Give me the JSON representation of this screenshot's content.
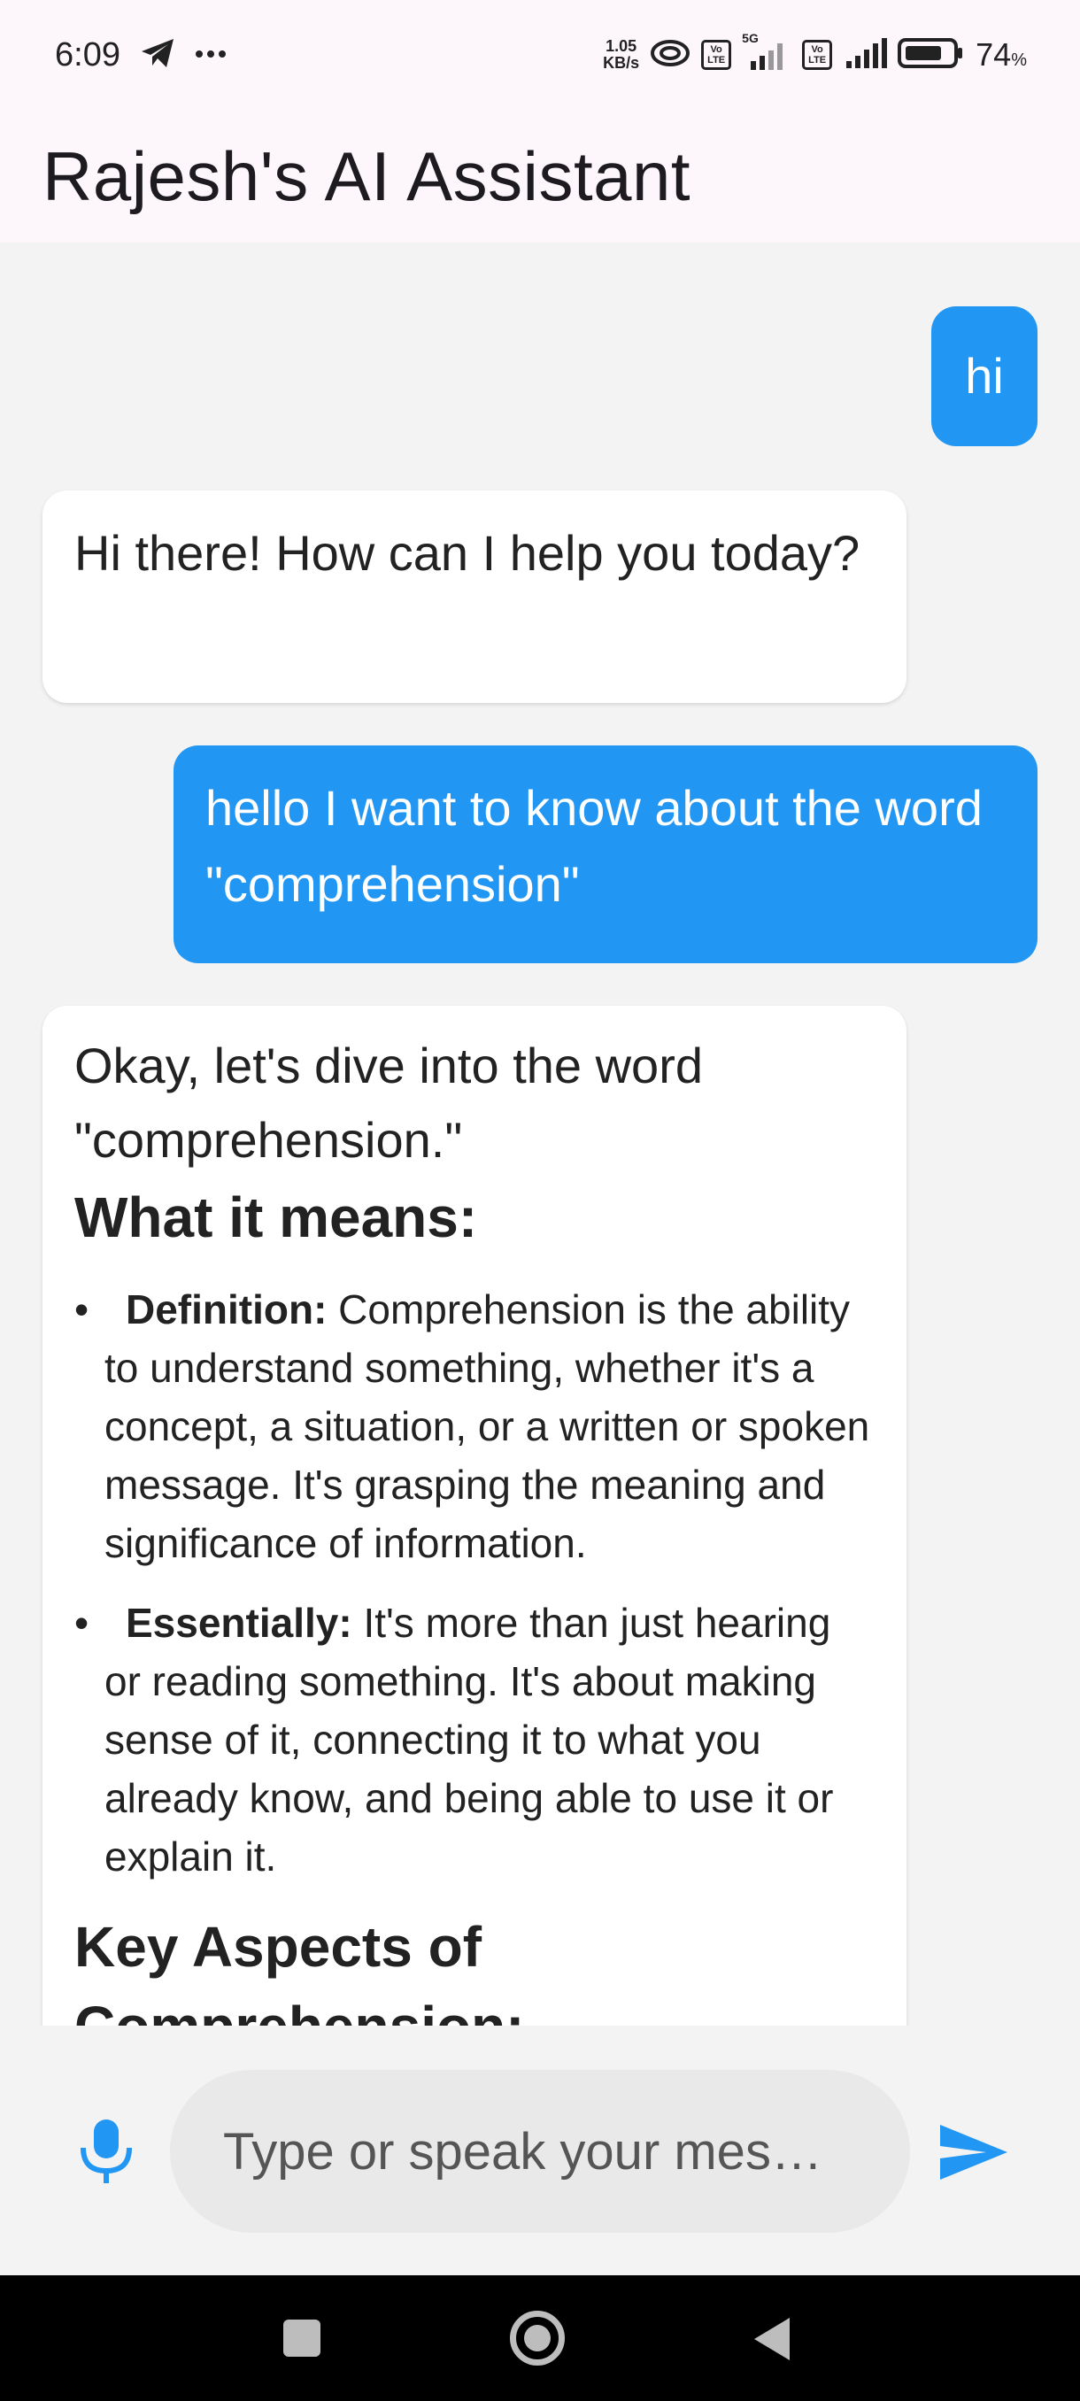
{
  "status_bar": {
    "time": "6:09",
    "net_speed_value": "1.05",
    "net_speed_unit": "KB/s",
    "lte_label_top": "Vo",
    "lte_label_bottom": "LTE",
    "sim1_network": "5G",
    "battery_percent": "74",
    "battery_unit": "%",
    "icons": [
      "telegram-icon",
      "more-dots-icon",
      "hotspot-icon",
      "volte-icon",
      "signal-icon",
      "battery-icon"
    ]
  },
  "app_bar": {
    "title": "Rajesh's AI Assistant"
  },
  "messages": [
    {
      "role": "user",
      "text": "hi"
    },
    {
      "role": "assistant",
      "text": "Hi there! How can I help you today?"
    },
    {
      "role": "user",
      "text": "hello I want to know about the word \"comprehension\""
    },
    {
      "role": "assistant",
      "intro": "Okay, let's dive into the word \"comprehension.\"",
      "heading1": "What it means:",
      "bullets": [
        {
          "label": "Definition:",
          "text": " Comprehension is the ability to understand something, whether it's a concept, a situation, or a written or spoken message. It's grasping the meaning and significance of information."
        },
        {
          "label": "Essentially:",
          "text": " It's more than just hearing or reading something. It's about making sense of it, connecting it to what you already know, and being able to use it or explain it."
        }
      ],
      "heading2": "Key Aspects of Comprehension:"
    }
  ],
  "input": {
    "placeholder": "Type or speak your mes…",
    "value": ""
  },
  "colors": {
    "user_bubble": "#2196f3",
    "assistant_bubble": "#ffffff",
    "app_bar_bg": "#fdf6fb",
    "accent": "#2196f3"
  }
}
